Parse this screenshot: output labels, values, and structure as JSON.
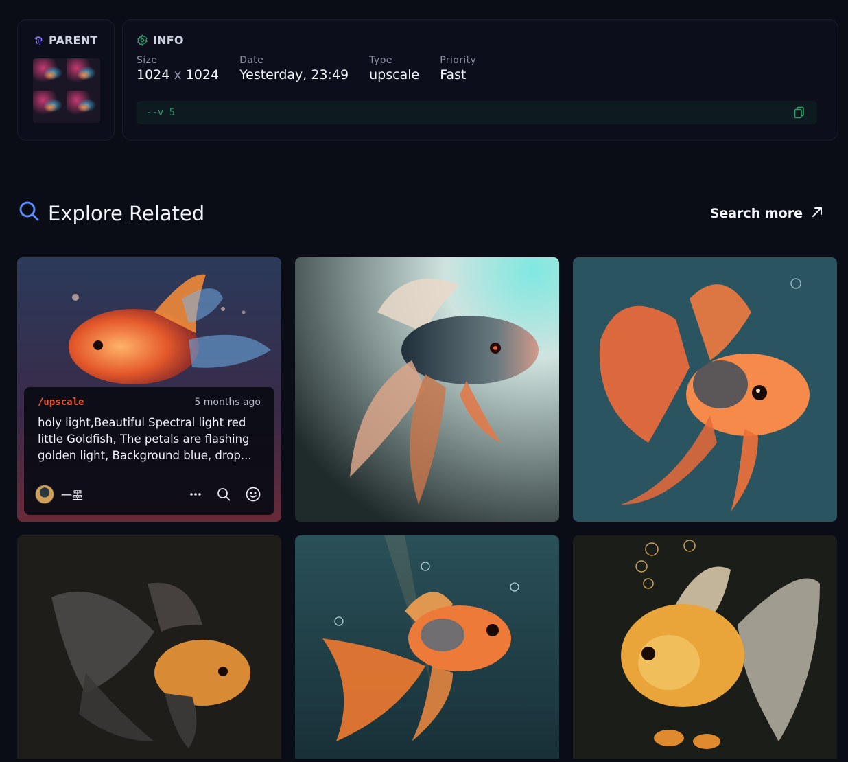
{
  "parent": {
    "heading": "PARENT"
  },
  "info": {
    "heading": "INFO",
    "size_label": "Size",
    "size_w": "1024",
    "size_x": "x",
    "size_h": "1024",
    "date_label": "Date",
    "date_value": "Yesterday, 23:49",
    "type_label": "Type",
    "type_value": "upscale",
    "priority_label": "Priority",
    "priority_value": "Fast",
    "prompt_params": "--v 5"
  },
  "explore": {
    "title": "Explore Related",
    "search_more": "Search more"
  },
  "featured": {
    "command": "/upscale",
    "time": "5 months ago",
    "prompt": "holy light,Beautiful Spectral light red little Goldfish, The petals are flashing golden light, Background blue, drop...",
    "username": "一墨"
  },
  "colors": {
    "background": "#0a0c16",
    "card": "#0c0f1b",
    "accent_green": "#2f9e6d",
    "accent_purple": "#8b7cf6",
    "command_orange": "#f0552d"
  },
  "icons": {
    "parent": "fingerprint-icon",
    "info": "gear-icon",
    "copy": "copy-icon",
    "explore": "search-icon",
    "search_more": "arrow-up-right-icon",
    "more": "more-dots-icon",
    "search": "search-icon",
    "react": "smiley-icon"
  }
}
